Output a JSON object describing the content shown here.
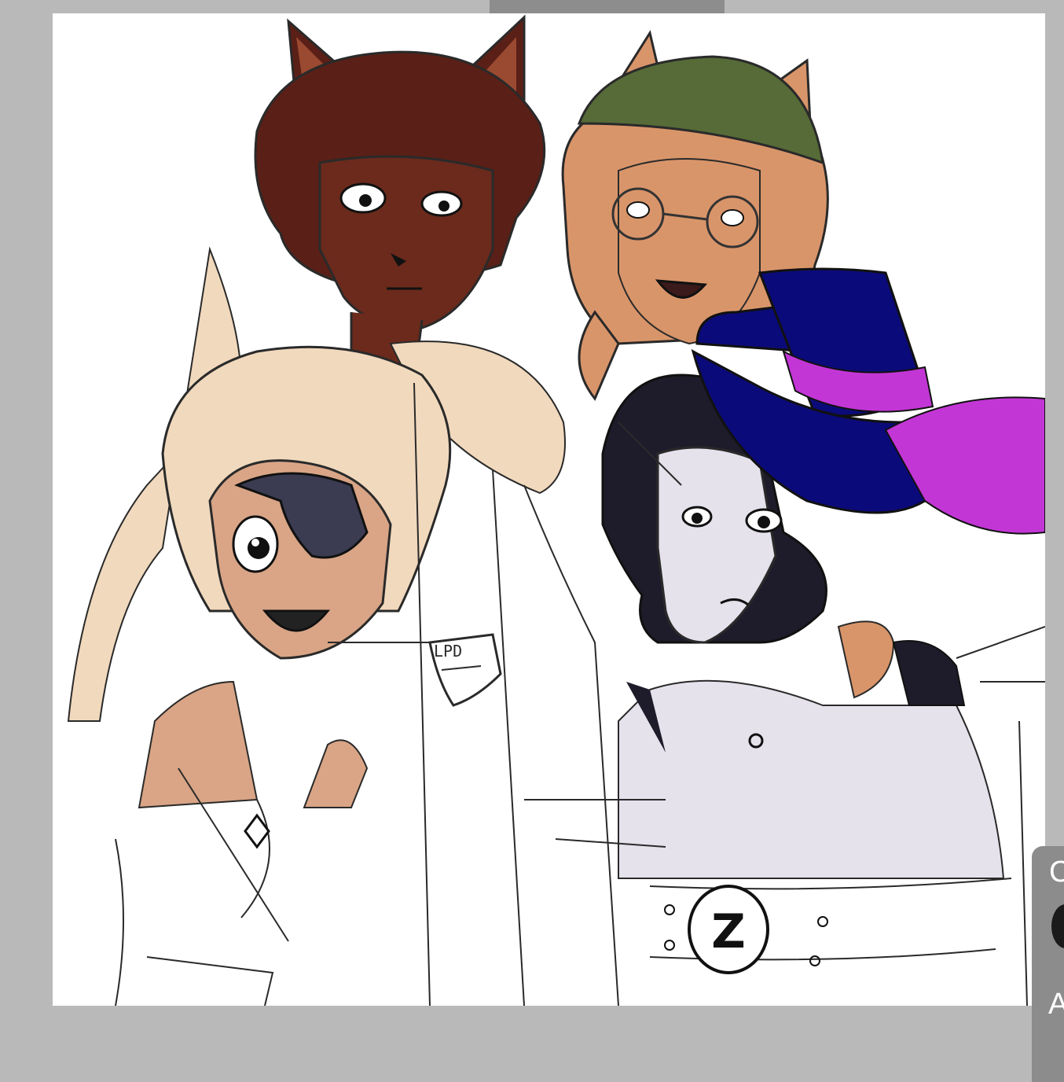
{
  "colors": {
    "app_background": "#b9b9b9",
    "canvas_background": "#ffffff",
    "panel_background": "#8c8c8c",
    "handle_background": "#8d8d8d",
    "line_art": "#2a2a2a",
    "hair_brown": "#5a1f16",
    "skin_dark": "#6b2a1c",
    "hair_ginger": "#d9956a",
    "beanie_green": "#566b37",
    "hair_blonde": "#f1d9bd",
    "skin_tan": "#d9a586",
    "eyepatch": "#3b3b52",
    "hair_black": "#1e1c2a",
    "skin_pale": "#e5e2ec",
    "top_hat": "#0b0a7a",
    "hat_band": "#c336d6"
  },
  "canvas": {
    "artwork_name": "character-sketch-artwork",
    "badge_text": "LPD",
    "belt_letter": "Z"
  },
  "side_panel": {
    "label_top": "C",
    "label_bottom": "A"
  }
}
